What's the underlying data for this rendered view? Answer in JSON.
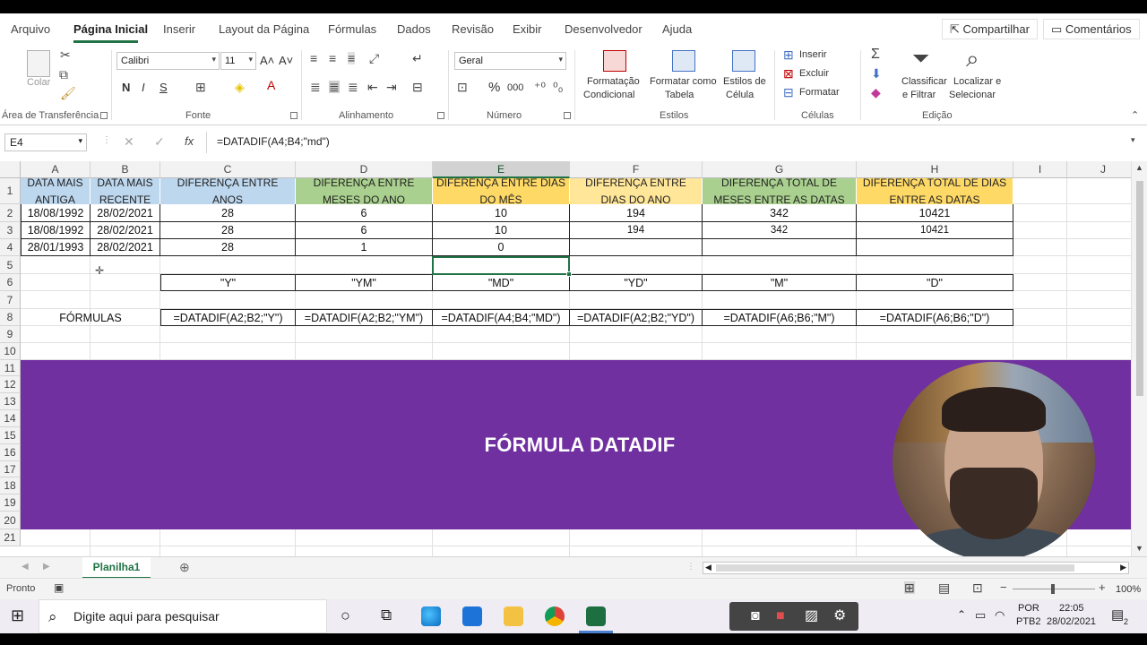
{
  "tabs": [
    "Arquivo",
    "Página Inicial",
    "Inserir",
    "Layout da Página",
    "Fórmulas",
    "Dados",
    "Revisão",
    "Exibir",
    "Desenvolvedor",
    "Ajuda"
  ],
  "share_label": "Compartilhar",
  "comments_label": "Comentários",
  "ribbon": {
    "paste_label": "Colar",
    "clipboard_label": "Área de Transferência",
    "font_name": "Calibri",
    "font_size": "11",
    "grow_font": "A˄",
    "shrink_font": "A˅",
    "bold": "N",
    "italic": "I",
    "underline": "S",
    "font_label": "Fonte",
    "align_label": "Alinhamento",
    "number_format": "Geral",
    "percent": "%",
    "thousands": "000",
    "number_label": "Número",
    "cond_format": [
      "Formatação",
      "Condicional"
    ],
    "format_table": [
      "Formatar como",
      "Tabela"
    ],
    "cell_styles": [
      "Estilos de",
      "Célula"
    ],
    "styles_label": "Estilos",
    "insert": "Inserir",
    "delete": "Excluir",
    "format": "Formatar",
    "cells_label": "Células",
    "sort_filter": [
      "Classificar",
      "e Filtrar"
    ],
    "find_select": [
      "Localizar e",
      "Selecionar"
    ],
    "editing_label": "Edição"
  },
  "formula_bar": {
    "name_box": "E4",
    "formula": "=DATADIF(A4;B4;\"md\")"
  },
  "columns": [
    "A",
    "B",
    "C",
    "D",
    "E",
    "F",
    "G",
    "H",
    "I",
    "J"
  ],
  "rows": [
    "1",
    "2",
    "3",
    "4",
    "5",
    "6",
    "7",
    "8",
    "9",
    "10",
    "11",
    "12",
    "13",
    "14",
    "15",
    "16",
    "17",
    "18",
    "19",
    "20",
    "21"
  ],
  "headers": [
    {
      "text": "DATA MAIS ANTIGA",
      "color": "#bdd7ee"
    },
    {
      "text": "DATA MAIS RECENTE",
      "color": "#bdd7ee"
    },
    {
      "text": "DIFERENÇA ENTRE ANOS",
      "color": "#bdd7ee"
    },
    {
      "text": "DIFERENÇA ENTRE MESES DO ANO",
      "color": "#a9d08e"
    },
    {
      "text": "DIFERENÇA ENTRE DIAS DO MÊS",
      "color": "#ffd966"
    },
    {
      "text": "DIFERENÇA ENTRE DIAS DO ANO",
      "color": "#ffe699"
    },
    {
      "text": "DIFERENÇA TOTAL DE MESES ENTRE AS DATAS",
      "color": "#a9d08e"
    },
    {
      "text": "DIFERENÇA TOTAL DE DIAS ENTRE AS DATAS",
      "color": "#ffd966"
    }
  ],
  "data_rows": [
    [
      "18/08/1992",
      "28/02/2021",
      "28",
      "6",
      "10",
      "194",
      "342",
      "10421"
    ],
    [
      "18/08/1992",
      "28/02/2021",
      "28",
      "6",
      "10",
      "194",
      "342",
      "10421"
    ],
    [
      "28/01/1993",
      "28/02/2021",
      "28",
      "1",
      "0",
      "",
      "",
      ""
    ]
  ],
  "codes": [
    "\"Y\"",
    "\"YM\"",
    "\"MD\"",
    "\"YD\"",
    "\"M\"",
    "\"D\""
  ],
  "formulas_label": "FÓRMULAS",
  "formulas": [
    "=DATADIF(A2;B2;\"Y\")",
    "=DATADIF(A2;B2;\"YM\")",
    "=DATADIF(A4;B4;\"MD\")",
    "=DATADIF(A2;B2;\"YD\")",
    "=DATADIF(A6;B6;\"M\")",
    "=DATADIF(A6;B6;\"D\")"
  ],
  "banner": {
    "title": "FÓRMULA DATADIF",
    "color": "#7030a0"
  },
  "sheet_tab": "Planilha1",
  "status": {
    "ready": "Pronto",
    "zoom": "100%"
  },
  "taskbar": {
    "search_placeholder": "Digite aqui para pesquisar",
    "lang1": "POR",
    "lang2": "PTB2",
    "time": "22:05",
    "date": "28/02/2021",
    "notifications": "2"
  }
}
